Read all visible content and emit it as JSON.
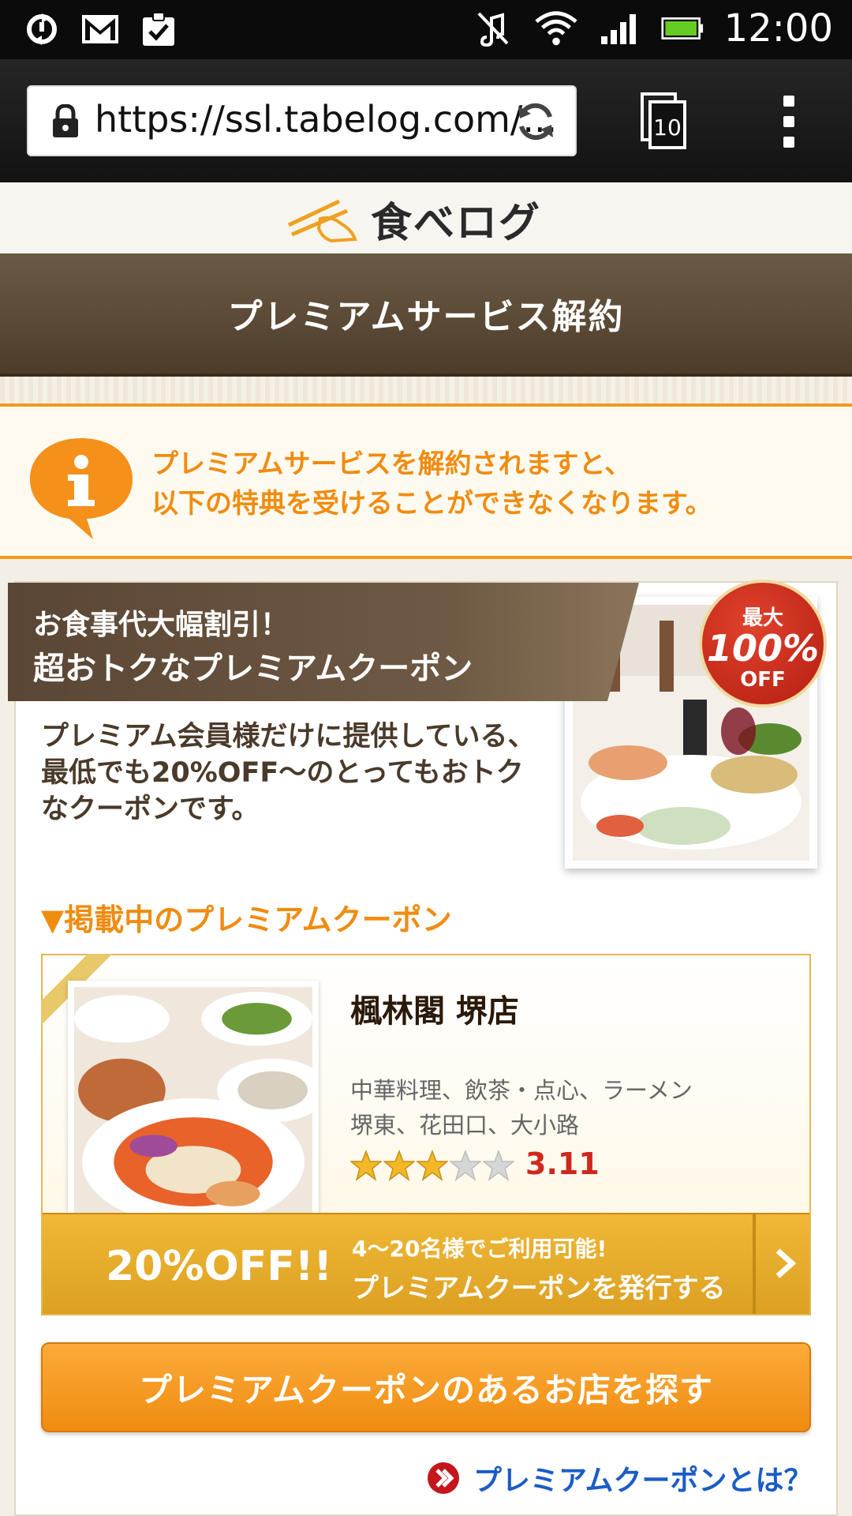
{
  "status_bar": {
    "time": "12:00",
    "icons_left": [
      "sync-icon",
      "gmail-icon",
      "task-check-icon"
    ],
    "icons_right": [
      "mute-icon",
      "wifi-icon",
      "signal-icon",
      "battery-icon"
    ]
  },
  "browser": {
    "url": "https://ssl.tabelog.com/...",
    "tab_count": "10"
  },
  "logo": {
    "text": "食べログ"
  },
  "page": {
    "title": "プレミアムサービス解約"
  },
  "notice": {
    "line1": "プレミアムサービスを解約されますと、",
    "line2": "以下の特典を受けることができなくなります。"
  },
  "coupon_promo": {
    "ribbon_line1": "お食事代大幅割引！",
    "ribbon_line2": "超おトクなプレミアムクーポン",
    "badge_top": "最大",
    "badge_value": "100%",
    "badge_bottom": "OFF",
    "description": "プレミアム会員様だけに提供している、最低でも20%OFF～のとってもおトクなクーポンです。"
  },
  "listing_heading": "▼掲載中のプレミアムクーポン",
  "shop": {
    "name": "楓林閣 堺店",
    "category": "中華料理、飲茶・点心、ラーメン",
    "area": "堺東、花田口、大小路",
    "rating": 3.11,
    "rating_text": "3.11",
    "stars_filled": 3,
    "stars_total": 5,
    "discount": "20%OFF!!",
    "action_line1": "4～20名様でご利用可能!",
    "action_line2": "プレミアムクーポンを発行する"
  },
  "buttons": {
    "search": "プレミアムクーポンのあるお店を探す"
  },
  "help_link": "プレミアムクーポンとは？",
  "colors": {
    "accent_orange": "#f08c10",
    "title_brown": "#5a4834",
    "score_red": "#d0271d",
    "link_blue": "#1a5cc8"
  }
}
